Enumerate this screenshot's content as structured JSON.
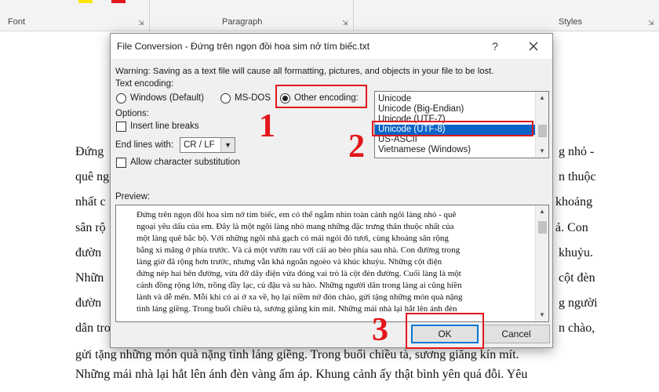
{
  "ribbon": {
    "font_group": "Font",
    "paragraph_group": "Paragraph",
    "styles_group": "Styles"
  },
  "document": {
    "lines_left": [
      "Đứng",
      "quê ngọ",
      "nhất c",
      "sân rộ",
      "đườn",
      "Nhữn",
      "đườn",
      "dân tro",
      "gửi tặng những món quà nặng tình láng giềng. Trong buổi chiều tà, sương giăng kín mít.",
      "Những mái nhà lại hắt lên ánh đèn vàng ấm áp. Khung cảnh ấy thật bình yên quá đỗi. Yêu"
    ],
    "lines_right": [
      "g nhỏ -",
      "n thuộc",
      "khoảng",
      "ả. Con",
      "khuỷu.",
      "cột đèn",
      "g người",
      "n chào,"
    ]
  },
  "dialog": {
    "title": "File Conversion - Đứng trên ngọn đồi hoa sim nở tím biếc.txt",
    "help_label": "?",
    "warning": "Warning: Saving as a text file will cause all formatting, pictures, and objects in your file to be lost.",
    "text_encoding_label": "Text encoding:",
    "encoding_options": {
      "windows": "Windows (Default)",
      "msdos": "MS-DOS",
      "other": "Other encoding:"
    },
    "options_label": "Options:",
    "insert_line_breaks": "Insert line breaks",
    "end_lines_label": "End lines with:",
    "end_lines_value": "CR / LF",
    "allow_substitution": "Allow character substitution",
    "encoding_list": [
      "Unicode",
      "Unicode (Big-Endian)",
      "Unicode (UTF-7)",
      "Unicode (UTF-8)",
      "US-ASCII",
      "Vietnamese (Windows)"
    ],
    "selected_encoding": "Unicode (UTF-8)",
    "preview_label": "Preview:",
    "preview_lines": [
      "Đứng trên ngọn đồi hoa sim nở tím biếc, em có thể ngắm nhìn toàn cảnh ngôi làng nhỏ - quê",
      "ngoại yêu dấu của em. Đây là một ngôi làng nhỏ mang những đặc trưng thân thuộc nhất của",
      "một làng quê bắc bộ. Với những ngôi nhà gạch có mái ngói đỏ tươi, cùng khoảng sân rộng",
      "bằng xi măng ở phía trước. Và cả một vườn rau với cái ao bèo phía sau nhà. Con đường trong",
      "làng giờ đã rộng hơn trước, nhưng vẫn khá ngoằn ngoèo và khúc khuỷu. Những cột điện",
      "đứng nép hai bên đường, vừa đỡ dây điện vừa đóng vai trò là cột đèn đường. Cuối làng là một",
      "cánh đồng rộng lớn, trồng đầy lạc, củ đậu và su hào. Những người dân trong làng ai cũng hiền",
      "lành và dễ mến. Mỗi khi có ai ở xa về, họ lại niềm nở đón chào, gửi tặng những món quà nặng",
      "tình láng giềng. Trong buổi chiều tà, sương giăng kín mít. Những mái nhà lại hắt lên ánh đèn"
    ],
    "ok_label": "OK",
    "cancel_label": "Cancel"
  },
  "annotations": {
    "step1": "1",
    "step2": "2",
    "step3": "3",
    "color": "#e3161b"
  },
  "colors": {
    "selection": "#0a64c8",
    "ok_border": "#0078d7"
  }
}
